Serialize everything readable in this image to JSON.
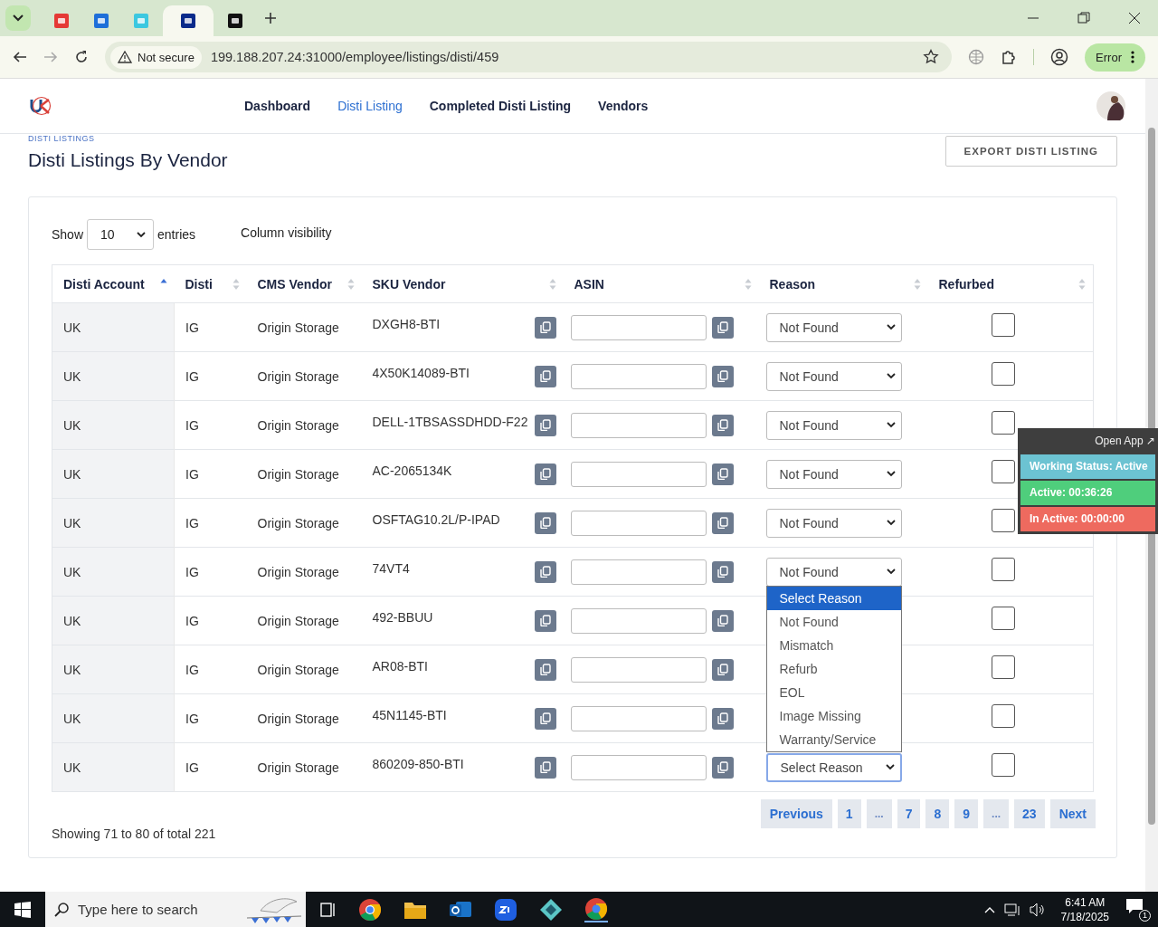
{
  "browser": {
    "tabs": [
      {
        "kind": "red",
        "selected": false
      },
      {
        "kind": "blue",
        "selected": false
      },
      {
        "kind": "cyan",
        "selected": false
      },
      {
        "kind": "navy",
        "selected": true
      },
      {
        "kind": "black",
        "selected": false
      }
    ],
    "security": "Not secure",
    "url": "199.188.207.24:31000/employee/listings/disti/459",
    "profile_status": "Error"
  },
  "nav": {
    "items": [
      {
        "label": "Dashboard",
        "selected": false
      },
      {
        "label": "Disti Listing",
        "selected": true
      },
      {
        "label": "Completed Disti Listing",
        "selected": false
      },
      {
        "label": "Vendors",
        "selected": false
      }
    ]
  },
  "page": {
    "breadcrumb": "DISTI LISTINGS",
    "title": "Disti Listings By Vendor",
    "export_button": "EXPORT DISTI LISTING"
  },
  "controls": {
    "show_label": "Show",
    "page_length": "10",
    "entries_label": "entries",
    "column_visibility": "Column visibility"
  },
  "table": {
    "columns": [
      {
        "label": "Disti Account",
        "sorted": true
      },
      {
        "label": "Disti",
        "sorted": false
      },
      {
        "label": "CMS Vendor",
        "sorted": false
      },
      {
        "label": "SKU Vendor",
        "sorted": false
      },
      {
        "label": "ASIN",
        "sorted": false
      },
      {
        "label": "Reason",
        "sorted": false
      },
      {
        "label": "Refurbed",
        "sorted": false
      }
    ],
    "rows": [
      {
        "account": "UK",
        "disti": "IG",
        "cms_vendor": "Origin Storage",
        "sku": "DXGH8-BTI",
        "reason": "Not Found",
        "focused": false,
        "refurbed": false
      },
      {
        "account": "UK",
        "disti": "IG",
        "cms_vendor": "Origin Storage",
        "sku": "4X50K14089-BTI",
        "reason": "Not Found",
        "focused": false,
        "refurbed": false
      },
      {
        "account": "UK",
        "disti": "IG",
        "cms_vendor": "Origin Storage",
        "sku": "DELL-1TBSASSDHDD-F22",
        "reason": "Not Found",
        "focused": false,
        "refurbed": false
      },
      {
        "account": "UK",
        "disti": "IG",
        "cms_vendor": "Origin Storage",
        "sku": "AC-2065134K",
        "reason": "Not Found",
        "focused": false,
        "refurbed": false
      },
      {
        "account": "UK",
        "disti": "IG",
        "cms_vendor": "Origin Storage",
        "sku": "OSFTAG10.2L/P-IPAD",
        "reason": "Not Found",
        "focused": false,
        "refurbed": false
      },
      {
        "account": "UK",
        "disti": "IG",
        "cms_vendor": "Origin Storage",
        "sku": "74VT4",
        "reason": "Not Found",
        "focused": false,
        "refurbed": false
      },
      {
        "account": "UK",
        "disti": "IG",
        "cms_vendor": "Origin Storage",
        "sku": "492-BBUU",
        "refurbed": false
      },
      {
        "account": "UK",
        "disti": "IG",
        "cms_vendor": "Origin Storage",
        "sku": "AR08-BTI",
        "refurbed": false
      },
      {
        "account": "UK",
        "disti": "IG",
        "cms_vendor": "Origin Storage",
        "sku": "45N1145-BTI",
        "refurbed": false
      },
      {
        "account": "UK",
        "disti": "IG",
        "cms_vendor": "Origin Storage",
        "sku": "860209-850-BTI",
        "reason": "Select Reason",
        "focused": true,
        "refurbed": false
      }
    ]
  },
  "reason_dropdown": {
    "options": [
      {
        "label": "Select Reason",
        "selected": true
      },
      {
        "label": "Not Found",
        "selected": false
      },
      {
        "label": "Mismatch",
        "selected": false
      },
      {
        "label": "Refurb",
        "selected": false
      },
      {
        "label": "EOL",
        "selected": false
      },
      {
        "label": "Image Missing",
        "selected": false
      },
      {
        "label": "Warranty/Service",
        "selected": false
      }
    ]
  },
  "info": "Showing 71 to 80 of total 221",
  "pagination": [
    {
      "label": "Previous",
      "kind": "nav"
    },
    {
      "label": "1",
      "kind": "page"
    },
    {
      "label": "...",
      "kind": "gap"
    },
    {
      "label": "7",
      "kind": "page"
    },
    {
      "label": "8",
      "kind": "page"
    },
    {
      "label": "9",
      "kind": "page"
    },
    {
      "label": "...",
      "kind": "gap"
    },
    {
      "label": "23",
      "kind": "page"
    },
    {
      "label": "Next",
      "kind": "nav"
    }
  ],
  "tracker": {
    "open_app": "Open App ↗",
    "rows": [
      {
        "label": "Working Status: Active",
        "color": "#6cc3d2"
      },
      {
        "label": "Active: 00:36:26",
        "color": "#4fce7c"
      },
      {
        "label": "In Active: 00:00:00",
        "color": "#ee6a5f"
      }
    ]
  },
  "taskbar": {
    "search_placeholder": "Type here to search",
    "time": "6:41 AM",
    "date": "7/18/2025",
    "notifications": "1"
  }
}
